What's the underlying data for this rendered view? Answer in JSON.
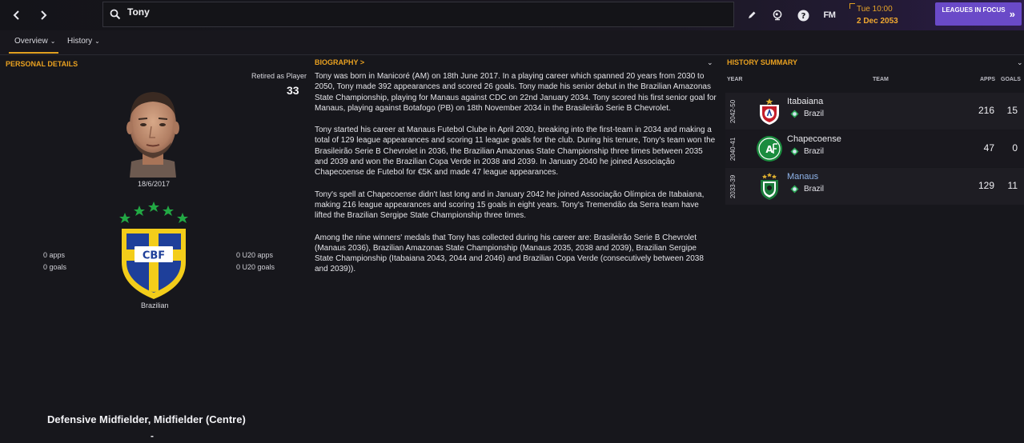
{
  "search": {
    "value": "Tony"
  },
  "header": {
    "fm_label": "FM",
    "time": "Tue 10:00",
    "date": "2 Dec 2053",
    "leagues_button": "LEAGUES IN FOCUS"
  },
  "tabs": [
    {
      "label": "Overview"
    },
    {
      "label": "History"
    }
  ],
  "personal": {
    "title": "PERSONAL DETAILS",
    "retired_label": "Retired as Player",
    "retired_value": "33",
    "dob": "18/6/2017",
    "nationality": "Brazilian",
    "apps": "0 apps",
    "goals": "0 goals",
    "u20_apps": "0 U20 apps",
    "u20_goals": "0 U20 goals",
    "crest_text": "CBF",
    "positions": "Defensive Midfielder, Midfielder (Centre)",
    "dash": "-"
  },
  "biography": {
    "title": "BIOGRAPHY >",
    "paragraphs": [
      "Tony was born in Manicoré (AM) on 18th June 2017. In a playing career which spanned 20 years from 2030 to 2050, Tony made 392 appearances and scored 26 goals. Tony made his senior debut in the Brazilian Amazonas State Championship, playing for Manaus against CDC on 22nd January 2034. Tony scored his first senior goal for Manaus, playing against Botafogo (PB) on 18th November 2034 in the Brasileirão Serie B Chevrolet.",
      "Tony started his career at Manaus Futebol Clube in April 2030, breaking into the first-team in 2034 and making a total of 129 league appearances and scoring 11 league goals for the club. During his tenure, Tony's team won the Brasileirão Serie B Chevrolet in 2036, the Brazilian Amazonas State Championship three times between 2035 and 2039 and won the Brazilian Copa Verde in 2038 and 2039. In January 2040 he joined Associação Chapecoense de Futebol for €5K and made 47 league appearances.",
      "Tony's spell at Chapecoense didn't last long and in January 2042 he joined Associação Olímpica de Itabaiana, making 216 league appearances and scoring 15 goals in eight years. Tony's Tremendão da Serra team have lifted the Brazilian Sergipe State Championship three times.",
      "Among the nine winners' medals that Tony has collected during his career are: Brasileirão Serie B Chevrolet (Manaus 2036), Brazilian Amazonas State Championship (Manaus 2035, 2038 and 2039), Brazilian Sergipe State Championship (Itabaiana 2043, 2044 and 2046) and Brazilian Copa Verde (consecutively between 2038 and 2039))."
    ]
  },
  "history": {
    "title": "HISTORY SUMMARY",
    "columns": {
      "year": "YEAR",
      "team": "TEAM",
      "apps": "APPS",
      "goals": "GOALS"
    },
    "rows": [
      {
        "years": "2042-50",
        "club": "Itabaiana",
        "country": "Brazil",
        "apps": "216",
        "goals": "15"
      },
      {
        "years": "2040-41",
        "club": "Chapecoense",
        "country": "Brazil",
        "apps": "47",
        "goals": "0"
      },
      {
        "years": "2033-39",
        "club": "Manaus",
        "country": "Brazil",
        "apps": "129",
        "goals": "11"
      }
    ]
  },
  "colors": {
    "accent": "#e8a020",
    "button": "#6a4ac8",
    "link": "#8fb4ea"
  }
}
